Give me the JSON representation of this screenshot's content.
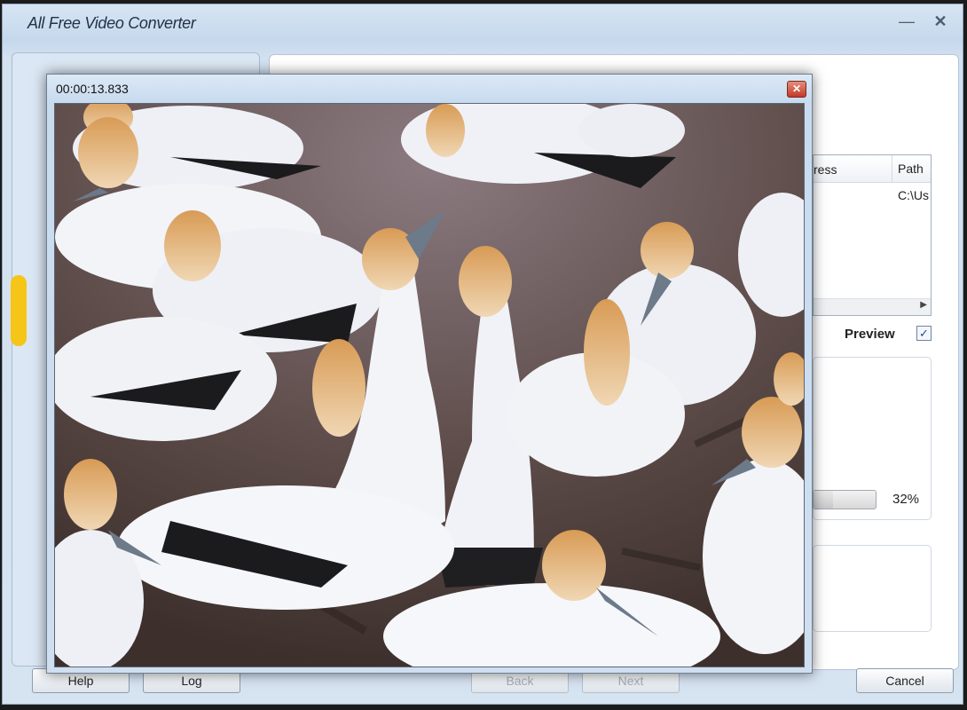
{
  "window": {
    "title": "All Free Video Converter",
    "minimize_icon": "minimize-icon",
    "close_icon": "close-icon"
  },
  "file_list": {
    "columns": [
      "ress",
      "Path"
    ],
    "rows": [
      {
        "path": "C:\\Us"
      }
    ],
    "scroll_icon": "chevron-right-icon"
  },
  "preview": {
    "label": "Preview",
    "checked": true,
    "check_icon": "checkmark-icon"
  },
  "progress": {
    "percent_text": "32%",
    "value": 0.32
  },
  "buttons": {
    "help": "Help",
    "log": "Log",
    "back": "Back",
    "next": "Next",
    "cancel": "Cancel"
  },
  "preview_window": {
    "timestamp": "00:00:13.833",
    "close_icon": "close-icon",
    "video_subject": "gannet colony video frame"
  },
  "colors": {
    "title_bar": "#d7e5f3",
    "close_button": "#c23a26",
    "preview_accent": "#2a4b8c"
  }
}
